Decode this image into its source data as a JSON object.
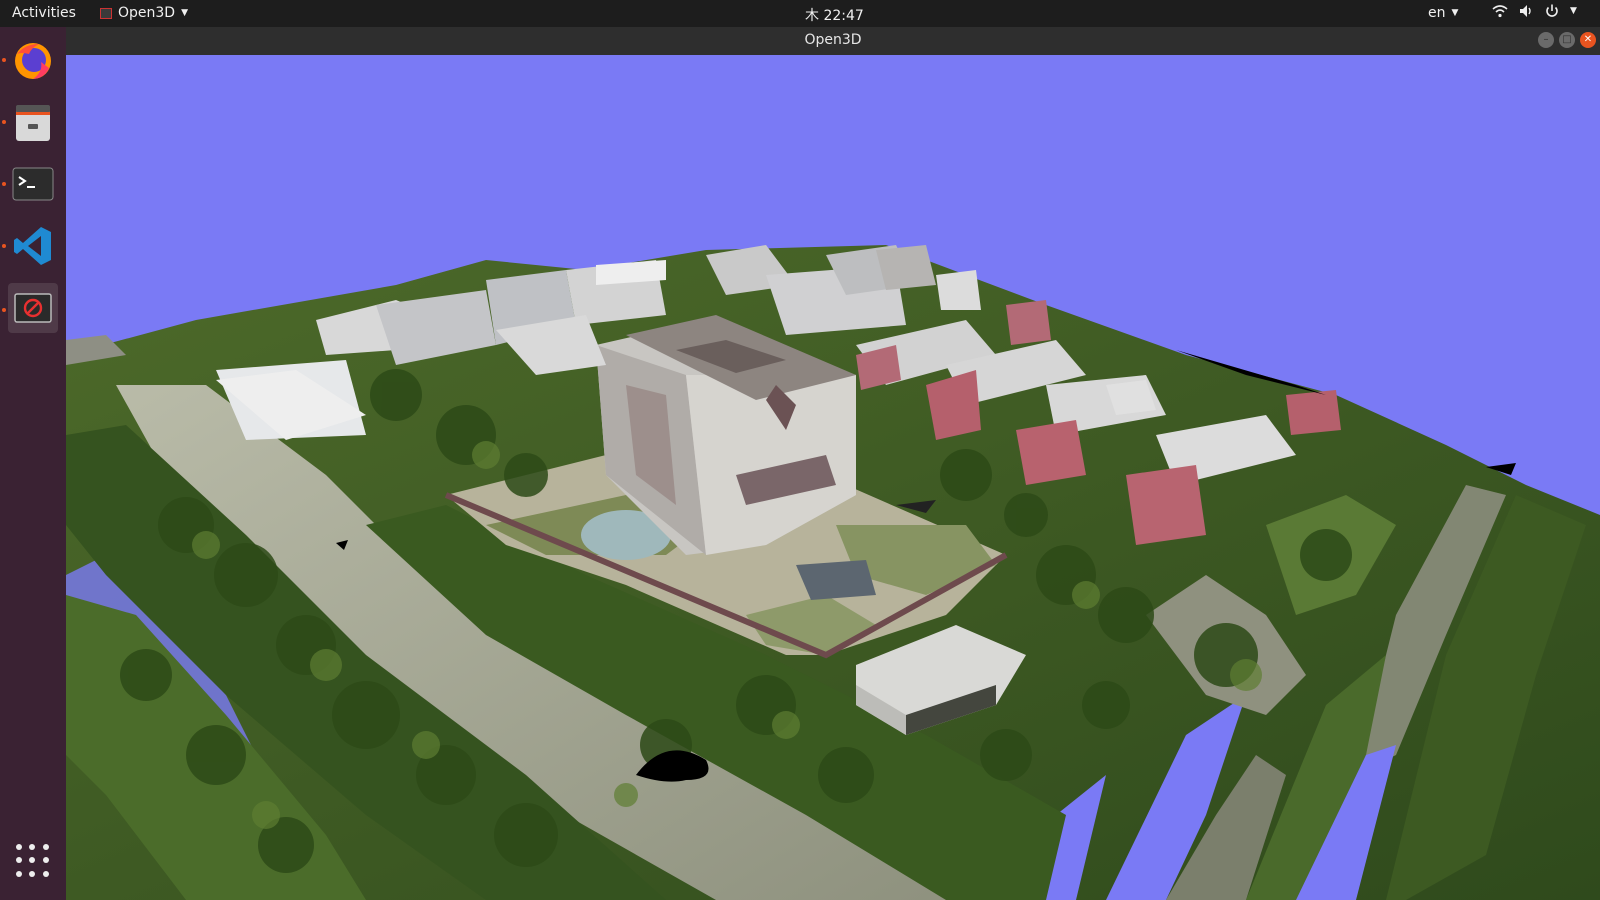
{
  "topbar": {
    "activities": "Activities",
    "app_menu": "Open3D",
    "clock": "木 22:47",
    "language": "en"
  },
  "window": {
    "title": "Open3D"
  },
  "dock": {
    "items": [
      "firefox-icon",
      "files-icon",
      "terminal-icon",
      "vscode-icon",
      "open3d-icon"
    ]
  },
  "colors": {
    "background": "#7a7af5",
    "topbar": "#1d1d1d",
    "dock": "#3a2233",
    "accent": "#e95420"
  }
}
